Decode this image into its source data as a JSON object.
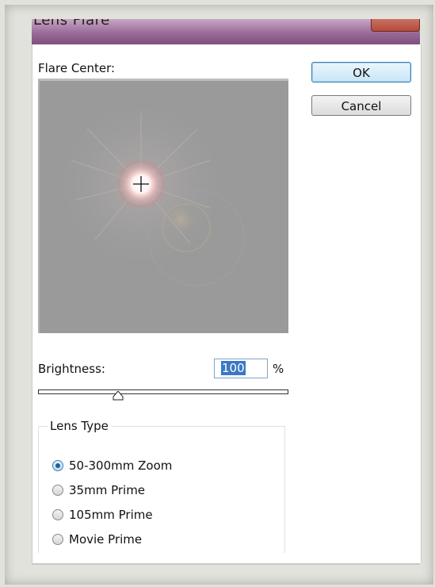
{
  "window": {
    "title": "Lens Flare"
  },
  "preview": {
    "label": "Flare Center:"
  },
  "buttons": {
    "ok": "OK",
    "cancel": "Cancel"
  },
  "brightness": {
    "label": "Brightness:",
    "value": "100",
    "unit": "%",
    "slider_fraction": 0.32
  },
  "lens_type": {
    "legend": "Lens Type",
    "options": [
      {
        "label": "50-300mm Zoom",
        "checked": true
      },
      {
        "label": "35mm Prime",
        "checked": false
      },
      {
        "label": "105mm Prime",
        "checked": false
      },
      {
        "label": "Movie Prime",
        "checked": false
      }
    ]
  },
  "colors": {
    "accent": "#3c7fb1",
    "titlebar": "#9a6b98",
    "preview_bg": "#9a9a9a"
  },
  "icons": {
    "close": "close-icon",
    "crosshair": "crosshair-icon",
    "slider": "slider-thumb-icon"
  }
}
